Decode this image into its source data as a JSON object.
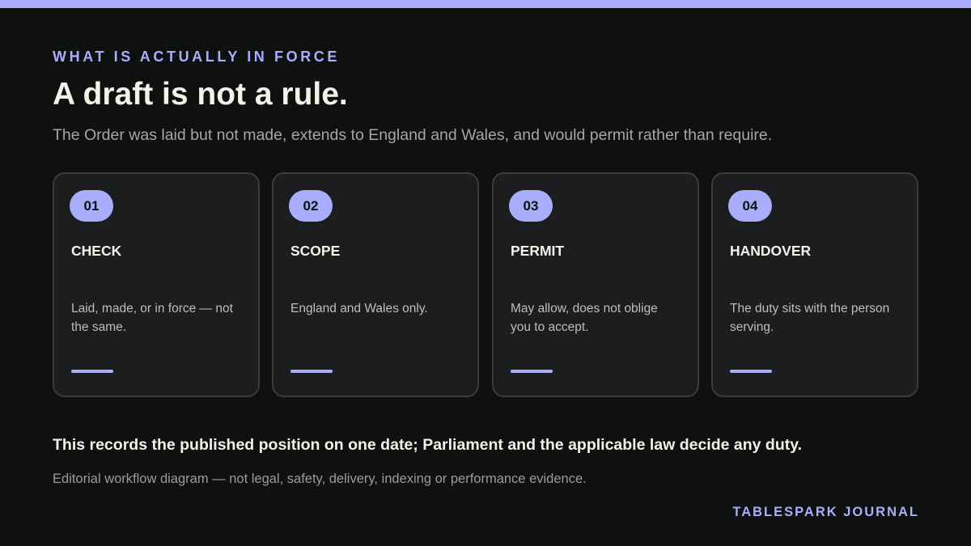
{
  "colors": {
    "background": "#0f1010",
    "accent": "#a8aefc",
    "card": "#1b1d1e",
    "card_border": "#3a3d3e",
    "heading": "#f4f1e8",
    "muted": "#a4a7a6"
  },
  "header": {
    "eyebrow": "WHAT IS ACTUALLY IN FORCE",
    "title": "A draft is not a rule.",
    "subtitle": "The Order was laid but not made, extends to England and Wales, and would permit rather than require."
  },
  "steps": [
    {
      "number": "01",
      "title": "CHECK",
      "body": "Laid, made, or in force — not the same."
    },
    {
      "number": "02",
      "title": "SCOPE",
      "body": "England and Wales only."
    },
    {
      "number": "03",
      "title": "PERMIT",
      "body": "May allow, does not oblige you to accept."
    },
    {
      "number": "04",
      "title": "HANDOVER",
      "body": "The duty sits with the person serving."
    }
  ],
  "footer": {
    "note": "This records the published position on one date; Parliament and the applicable law decide any duty.",
    "disclaimer": "Editorial workflow diagram — not legal, safety, delivery, indexing or performance evidence.",
    "brand": "TABLESPARK JOURNAL"
  }
}
